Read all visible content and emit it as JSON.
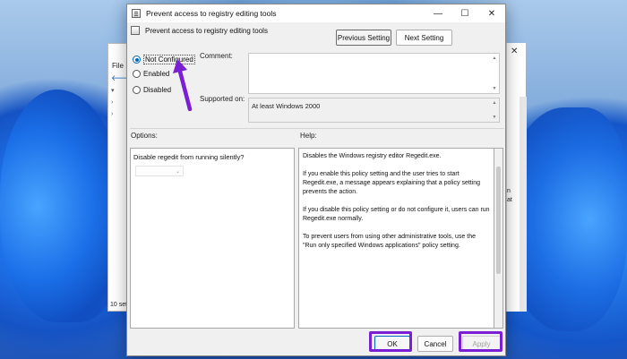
{
  "background_window": {
    "menu_label": "File",
    "status_text": "10 sett",
    "right_fragments": [
      "n",
      "at"
    ]
  },
  "dialog": {
    "title": "Prevent access to registry editing tools",
    "policy_name": "Prevent access to registry editing tools",
    "window_controls": {
      "minimize": "—",
      "maximize": "☐",
      "close": "✕"
    },
    "nav": {
      "previous": "Previous Setting",
      "next": "Next Setting"
    },
    "state_options": [
      {
        "label": "Not Configured",
        "selected": true
      },
      {
        "label": "Enabled",
        "selected": false
      },
      {
        "label": "Disabled",
        "selected": false
      }
    ],
    "comment_label": "Comment:",
    "comment_value": "",
    "supported_label": "Supported on:",
    "supported_value": "At least Windows 2000",
    "options_label": "Options:",
    "help_label": "Help:",
    "options_text": "Disable regedit from running silently?",
    "options_dropdown_value": "",
    "help_paragraphs": [
      "Disables the Windows registry editor Regedit.exe.",
      "If you enable this policy setting and the user tries to start Regedit.exe, a message appears explaining that a policy setting prevents the action.",
      "If you disable this policy setting or do not configure it, users can run Regedit.exe normally.",
      "To prevent users from using other administrative tools, use the \"Run only specified Windows applications\" policy setting."
    ],
    "buttons": {
      "ok": "OK",
      "cancel": "Cancel",
      "apply": "Apply"
    }
  },
  "annotations": {
    "highlight_color": "#7a1fd3",
    "highlighted_buttons": [
      "ok",
      "apply"
    ]
  },
  "colors": {
    "accent": "#0067c0",
    "dialog_bg": "#f0f0f0"
  }
}
